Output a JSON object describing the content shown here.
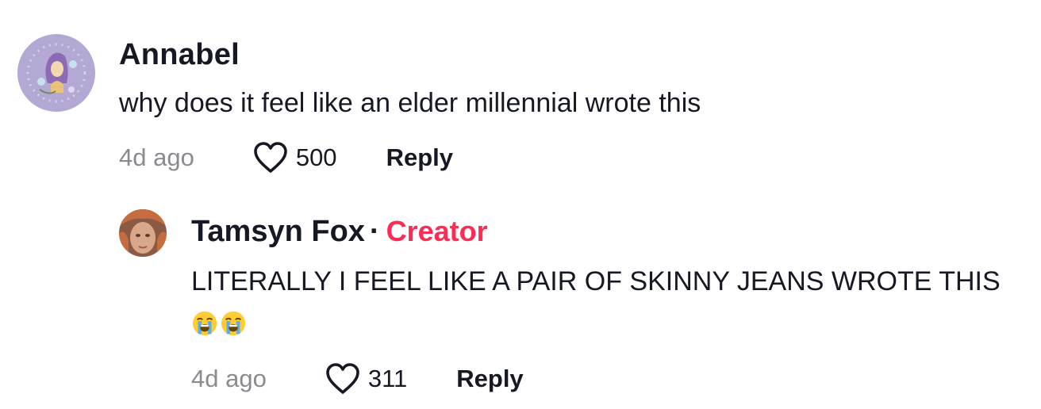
{
  "comments": [
    {
      "author": "Annabel",
      "text": "why does it feel like an elder millennial wrote this",
      "time": "4d ago",
      "likes": "500",
      "reply_label": "Reply"
    }
  ],
  "reply": {
    "author": "Tamsyn Fox",
    "separator": "·",
    "badge": "Creator",
    "text": "LITERALLY I FEEL LIKE A PAIR OF SKINNY JEANS WROTE THIS",
    "emojis": [
      "loudly-crying-face",
      "loudly-crying-face"
    ],
    "time": "4d ago",
    "likes": "311",
    "reply_label": "Reply"
  },
  "colors": {
    "creator_badge": "#fe2c55",
    "timestamp": "#8a8b91",
    "text": "#161823",
    "avatar_bg": "#b4a8d4"
  }
}
